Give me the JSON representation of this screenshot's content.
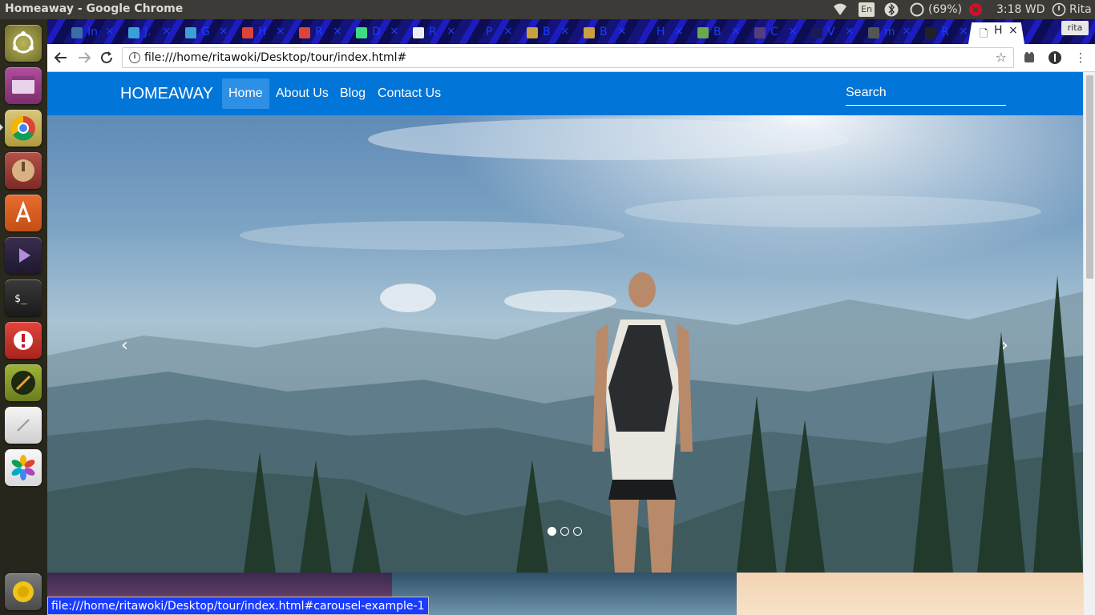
{
  "os": {
    "window_title": "Homeaway - Google Chrome",
    "keyboard_layout": "En",
    "battery": "(69%)",
    "clock": "3:18 WD",
    "user": "Rita"
  },
  "launcher": {
    "items": [
      "ubuntu-dash",
      "file-manager",
      "chrome",
      "archive-manager",
      "software-center",
      "media-player",
      "terminal",
      "update-notifier",
      "text-editor",
      "notes",
      "photos",
      "trash"
    ]
  },
  "tabs": [
    {
      "label": "In",
      "icon": "doc-icon"
    },
    {
      "label": "J.",
      "icon": "mail-icon"
    },
    {
      "label": "G",
      "icon": "mail-icon"
    },
    {
      "label": "H",
      "icon": "chrome-icon"
    },
    {
      "label": "R",
      "icon": "chrome-icon"
    },
    {
      "label": "D",
      "icon": "android-icon"
    },
    {
      "label": "R",
      "icon": "page-icon"
    },
    {
      "label": "P",
      "icon": ""
    },
    {
      "label": "B",
      "icon": "beer-icon"
    },
    {
      "label": "B",
      "icon": "beer-icon"
    },
    {
      "label": "H",
      "icon": ""
    },
    {
      "label": "B",
      "icon": "frog-icon"
    },
    {
      "label": "C",
      "icon": "bootstrap-icon"
    },
    {
      "label": "V",
      "icon": "mdb-icon"
    },
    {
      "label": "m",
      "icon": "hash-icon"
    },
    {
      "label": "R",
      "icon": "github-icon"
    }
  ],
  "active_tab": {
    "label": "H",
    "close": "×"
  },
  "tab_close": "×",
  "profile_badge": "rita",
  "toolbar": {
    "url": "file:///home/ritawoki/Desktop/tour/index.html#"
  },
  "site": {
    "brand": "HOMEAWAY",
    "nav": [
      {
        "label": "Home",
        "active": true
      },
      {
        "label": "About Us",
        "active": false
      },
      {
        "label": "Blog",
        "active": false
      },
      {
        "label": "Contact Us",
        "active": false
      }
    ],
    "search_placeholder": "Search",
    "carousel": {
      "prev": "‹",
      "next": "›",
      "slide_count": 3,
      "active_index": 0
    }
  },
  "status_bar": "file:///home/ritawoki/Desktop/tour/index.html#carousel-example-1",
  "colors": {
    "navbar": "#0275d8",
    "ubuntu_panel": "#3c3b37"
  }
}
